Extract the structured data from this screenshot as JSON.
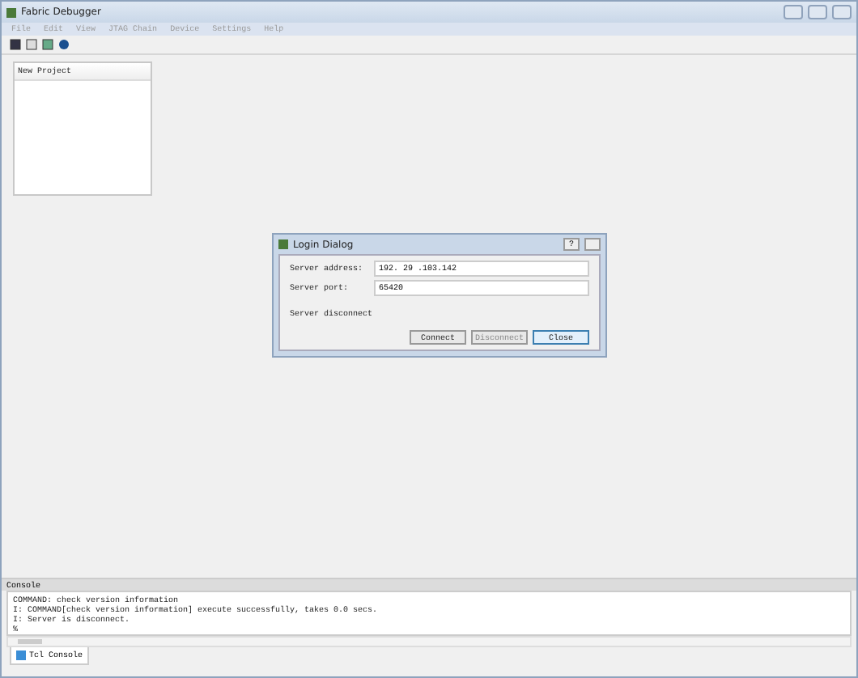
{
  "window": {
    "title": "Fabric Debugger"
  },
  "menu": [
    "File",
    "Edit",
    "View",
    "JTAG Chain",
    "Device",
    "Settings",
    "Help"
  ],
  "project_panel": {
    "items": [
      "New Project"
    ]
  },
  "dialog": {
    "title": "Login Dialog",
    "help": "?",
    "fields": [
      {
        "label": "Server address:",
        "value": "192. 29 .103.142"
      },
      {
        "label": "Server port:",
        "value": "65420"
      }
    ],
    "status": "Server disconnect",
    "buttons": [
      {
        "label": "Connect",
        "disabled": false,
        "selected": false
      },
      {
        "label": "Disconnect",
        "disabled": true,
        "selected": false
      },
      {
        "label": "Close",
        "disabled": false,
        "selected": true
      }
    ]
  },
  "console": {
    "title": "Console",
    "lines": [
      "COMMAND: check version information",
      "I: COMMAND[check version information] execute successfully, takes 0.0 secs.",
      "I: Server is disconnect.",
      "%"
    ],
    "tabs": [
      {
        "label": "Tcl Console",
        "selected": true
      }
    ]
  }
}
